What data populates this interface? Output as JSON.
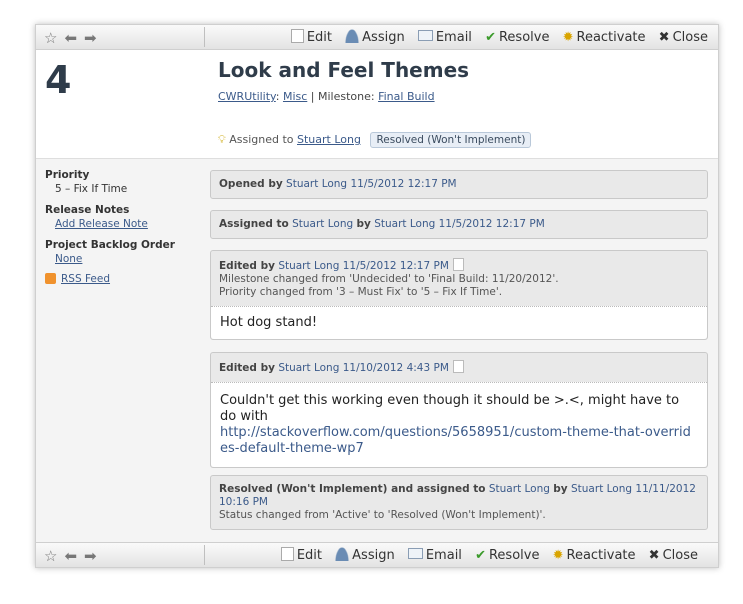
{
  "toolbar": {
    "edit": "Edit",
    "assign": "Assign",
    "email": "Email",
    "resolve": "Resolve",
    "reactivate": "Reactivate",
    "close": "Close"
  },
  "case": {
    "number": "4",
    "title": "Look and Feel Themes",
    "project": "CWRUtility",
    "area": "Misc",
    "milestone_label": "Milestone:",
    "milestone": "Final Build",
    "assigned_prefix": "Assigned to",
    "assigned_to": "Stuart Long",
    "status": "Resolved (Won't Implement)"
  },
  "sidebar": {
    "priority_label": "Priority",
    "priority_value": "5 – Fix If Time",
    "release_label": "Release Notes",
    "release_link": "Add Release Note",
    "backlog_label": "Project Backlog Order",
    "backlog_value": "None",
    "rss": "RSS Feed"
  },
  "events": [
    {
      "action": "Opened by",
      "user": "Stuart Long",
      "date": "11/5/2012 12:17 PM"
    },
    {
      "action": "Assigned to",
      "target": "Stuart Long",
      "by": "by",
      "user": "Stuart Long",
      "date": "11/5/2012 12:17 PM"
    },
    {
      "action": "Edited by",
      "user": "Stuart Long",
      "date": "11/5/2012 12:17 PM",
      "change1": "Milestone changed from 'Undecided' to 'Final Build: 11/20/2012'.",
      "change2": "Priority changed from '3 – Must Fix' to '5 – Fix If Time'.",
      "body": "Hot dog stand!"
    },
    {
      "action": "Edited by",
      "user": "Stuart Long",
      "date": "11/10/2012 4:43 PM",
      "body": "Couldn't get this working even though it should be >.<, might have to do with",
      "link": "http://stackoverflow.com/questions/5658951/custom-theme-that-overrides-default-theme-wp7"
    },
    {
      "action": "Resolved (Won't Implement) and assigned to",
      "target": "Stuart Long",
      "by": "by",
      "user": "Stuart Long",
      "date": "11/11/2012 10:16 PM",
      "change1": "Status changed from 'Active' to 'Resolved (Won't Implement)'."
    }
  ],
  "colors": {
    "accent": "#3b5a8a",
    "title": "#2f3c4a"
  }
}
